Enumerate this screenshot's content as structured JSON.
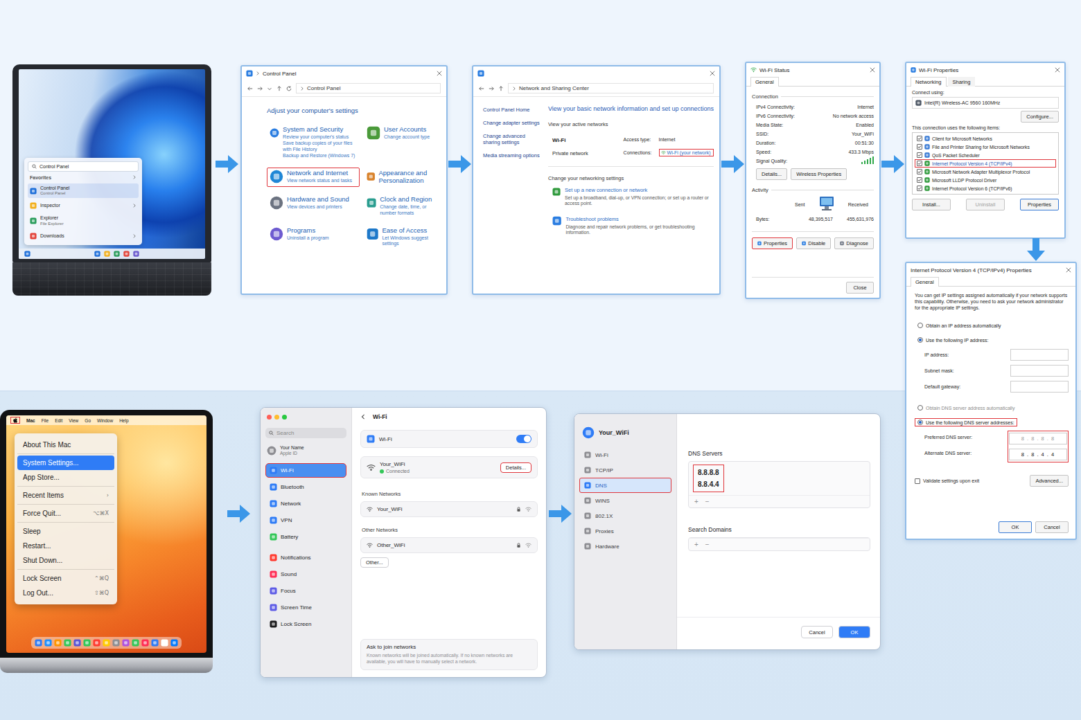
{
  "windows_laptop": {
    "search": "Control Panel",
    "section": "Favorites",
    "items": [
      {
        "label": "Control Panel",
        "sub": "Control Panel",
        "selected": true
      },
      {
        "label": "Inspector",
        "selected": false
      },
      {
        "label": "Explorer",
        "sub": "File Explorer",
        "selected": false
      },
      {
        "label": "Downloads",
        "selected": false
      }
    ]
  },
  "control_panel": {
    "title": "Control Panel",
    "address": "Control Panel",
    "heading": "Adjust your computer's settings",
    "categories": [
      {
        "title": "System and Security",
        "links": [
          "Review your computer's status",
          "Save backup copies of your files with File History",
          "Backup and Restore (Windows 7)"
        ],
        "highlighted": false
      },
      {
        "title": "User Accounts",
        "links": [
          "Change account type"
        ],
        "highlighted": false
      },
      {
        "title": "Network and Internet",
        "links": [
          "View network status and tasks"
        ],
        "highlighted": true
      },
      {
        "title": "Appearance and Personalization",
        "links": [],
        "highlighted": false
      },
      {
        "title": "Hardware and Sound",
        "links": [
          "View devices and printers"
        ],
        "highlighted": false
      },
      {
        "title": "Clock and Region",
        "links": [
          "Change date, time, or number formats"
        ],
        "highlighted": false
      },
      {
        "title": "Programs",
        "links": [
          "Uninstall a program"
        ],
        "highlighted": false
      },
      {
        "title": "Ease of Access",
        "links": [
          "Let Windows suggest settings"
        ],
        "highlighted": false
      }
    ]
  },
  "network_center": {
    "title": "Network and Sharing Center",
    "sidebar": [
      "Control Panel Home",
      "Change adapter settings",
      "Change advanced sharing settings",
      "Media streaming options"
    ],
    "heading": "View your basic network information and set up connections",
    "active_label": "View your active networks",
    "network_name": "Wi-Fi",
    "network_type": "Private network",
    "access_label": "Access type:",
    "access_value": "Internet",
    "connections_label": "Connections:",
    "connection": "Wi-Fi (your network)",
    "connection_highlighted": true,
    "change_label": "Change your networking settings",
    "tasks": [
      {
        "title": "Set up a new connection or network",
        "desc": "Set up a broadband, dial-up, or VPN connection; or set up a router or access point."
      },
      {
        "title": "Troubleshoot problems",
        "desc": "Diagnose and repair network problems, or get troubleshooting information."
      }
    ]
  },
  "wifi_status": {
    "title": "Wi-Fi Status",
    "tab": "General",
    "connection_label": "Connection",
    "rows": [
      {
        "label": "IPv4 Connectivity:",
        "value": "Internet"
      },
      {
        "label": "IPv6 Connectivity:",
        "value": "No network access"
      },
      {
        "label": "Media State:",
        "value": "Enabled"
      },
      {
        "label": "SSID:",
        "value": "Your_WiFi"
      },
      {
        "label": "Duration:",
        "value": "00:51:30"
      },
      {
        "label": "Speed:",
        "value": "433.3 Mbps"
      }
    ],
    "signal_label": "Signal Quality:",
    "signal_level": 1,
    "detail_buttons": [
      "Details...",
      "Wireless Properties"
    ],
    "activity_label": "Activity",
    "sent_label": "Sent",
    "received_label": "Received",
    "bytes_label": "Bytes:",
    "bytes_sent": "48,395,517",
    "bytes_received": "455,631,976",
    "actions": [
      {
        "label": "Properties",
        "highlighted": true
      },
      {
        "label": "Disable",
        "highlighted": false
      },
      {
        "label": "Diagnose",
        "highlighted": false
      }
    ],
    "close": "Close"
  },
  "wifi_properties": {
    "title": "Wi-Fi Properties",
    "tabs": [
      {
        "label": "Networking",
        "selected": true
      },
      {
        "label": "Sharing",
        "selected": false
      }
    ],
    "connect_label": "Connect using:",
    "adapter": "Intel(R) Wireless-AC 9560 160MHz",
    "configure": "Configure...",
    "items_label": "This connection uses the following items:",
    "items": [
      {
        "label": "Client for Microsoft Networks",
        "checked": true,
        "highlighted": false
      },
      {
        "label": "File and Printer Sharing for Microsoft Networks",
        "checked": true,
        "highlighted": false
      },
      {
        "label": "QoS Packet Scheduler",
        "checked": true,
        "highlighted": false
      },
      {
        "label": "Internet Protocol Version 4 (TCP/IPv4)",
        "checked": true,
        "highlighted": true
      },
      {
        "label": "Microsoft Network Adapter Multiplexor Protocol",
        "checked": true,
        "highlighted": false
      },
      {
        "label": "Microsoft LLDP Protocol Driver",
        "checked": true,
        "highlighted": false
      },
      {
        "label": "Internet Protocol Version 6 (TCP/IPv6)",
        "checked": true,
        "highlighted": false
      }
    ],
    "buttons": [
      {
        "label": "Install...",
        "disabled": false,
        "focused": false
      },
      {
        "label": "Uninstall",
        "disabled": true,
        "focused": false
      },
      {
        "label": "Properties",
        "disabled": false,
        "focused": true
      }
    ]
  },
  "ipv4": {
    "title": "Internet Protocol Version 4 (TCP/IPv4) Properties",
    "tab": "General",
    "intro": "You can get IP settings assigned automatically if your network supports this capability. Otherwise, you need to ask your network administrator for the appropriate IP settings.",
    "ip_options": [
      {
        "label": "Obtain an IP address automatically",
        "selected": false,
        "disabled": false,
        "highlighted": false
      },
      {
        "label": "Use the following IP address:",
        "selected": true,
        "disabled": false,
        "highlighted": false
      }
    ],
    "ip_fields": [
      "IP address:",
      "Subnet mask:",
      "Default gateway:"
    ],
    "dns_options": [
      {
        "label": "Obtain DNS server address automatically",
        "selected": false,
        "disabled": true,
        "highlighted": false
      },
      {
        "label": "Use the following DNS server addresses:",
        "selected": true,
        "disabled": false,
        "highlighted": true
      }
    ],
    "dns_fields": [
      {
        "label": "Preferred DNS server:",
        "value": "8 . 8 . 8 . 8",
        "dimmed": true
      },
      {
        "label": "Alternate DNS server:",
        "value": "8 . 8 . 4 . 4",
        "dimmed": false
      }
    ],
    "dns_fields_highlighted": true,
    "validate": {
      "label": "Validate settings upon exit",
      "checked": false
    },
    "advanced": "Advanced...",
    "buttons": [
      {
        "label": "OK",
        "focused": true
      },
      {
        "label": "Cancel",
        "focused": false
      }
    ]
  },
  "mac_laptop": {
    "menubar": [
      "Mac",
      "File",
      "Edit",
      "View",
      "Go",
      "Window",
      "Help"
    ],
    "apple_highlighted": true,
    "menu": [
      [
        {
          "label": "About This Mac",
          "selected": false
        }
      ],
      [
        {
          "label": "System Settings...",
          "selected": true
        },
        {
          "label": "App Store...",
          "selected": false
        }
      ],
      [
        {
          "label": "Recent Items",
          "shortcut": "›",
          "selected": false
        }
      ],
      [
        {
          "label": "Force Quit...",
          "shortcut": "⌥⌘X",
          "selected": false
        }
      ],
      [
        {
          "label": "Sleep",
          "selected": false
        },
        {
          "label": "Restart...",
          "selected": false
        },
        {
          "label": "Shut Down...",
          "selected": false
        }
      ],
      [
        {
          "label": "Lock Screen",
          "shortcut": "⌃⌘Q",
          "selected": false
        },
        {
          "label": "Log Out...",
          "shortcut": "⇧⌘Q",
          "selected": false
        }
      ]
    ]
  },
  "mac_settings": {
    "search": "Search",
    "account": {
      "name": "Your Name",
      "sub": "Apple ID"
    },
    "sidebar": [
      [
        {
          "label": "Wi-Fi",
          "selected": true
        },
        {
          "label": "Bluetooth",
          "selected": false
        },
        {
          "label": "Network",
          "selected": false
        },
        {
          "label": "VPN",
          "selected": false
        },
        {
          "label": "Battery",
          "selected": false
        }
      ],
      [
        {
          "label": "Notifications",
          "selected": false
        },
        {
          "label": "Sound",
          "selected": false
        },
        {
          "label": "Focus",
          "selected": false
        },
        {
          "label": "Screen Time",
          "selected": false
        },
        {
          "label": "Lock Screen",
          "selected": false
        }
      ]
    ],
    "title": "Wi-Fi",
    "wifi_toggle": {
      "label": "Wi-Fi",
      "on": true
    },
    "current": {
      "name": "Your_WiFi",
      "status": "Connected",
      "details": "Details...",
      "details_highlighted": true
    },
    "known_label": "Known Networks",
    "known": [
      {
        "name": "Your_WiFi",
        "locked": true
      }
    ],
    "other_label": "Other Networks",
    "others": [
      {
        "name": "Other_WiFi",
        "locked": true
      }
    ],
    "other_button": "Other...",
    "ask": {
      "title": "Ask to join networks",
      "desc": "Known networks will be joined automatically. If no known networks are available, you will have to manually select a network."
    }
  },
  "dns_panel": {
    "title": "Your_WiFi",
    "sidebar": [
      {
        "label": "Wi-Fi",
        "selected": false
      },
      {
        "label": "TCP/IP",
        "selected": false
      },
      {
        "label": "DNS",
        "selected": true
      },
      {
        "label": "WINS",
        "selected": false
      },
      {
        "label": "802.1X",
        "selected": false
      },
      {
        "label": "Proxies",
        "selected": false
      },
      {
        "label": "Hardware",
        "selected": false
      }
    ],
    "dns_label": "DNS Servers",
    "dns_servers": [
      "8.8.8.8",
      "8.8.4.4"
    ],
    "dns_highlighted": true,
    "add": "+",
    "remove": "−",
    "search_label": "Search Domains",
    "buttons": [
      {
        "label": "Cancel",
        "primary": false
      },
      {
        "label": "OK",
        "primary": true
      }
    ]
  }
}
